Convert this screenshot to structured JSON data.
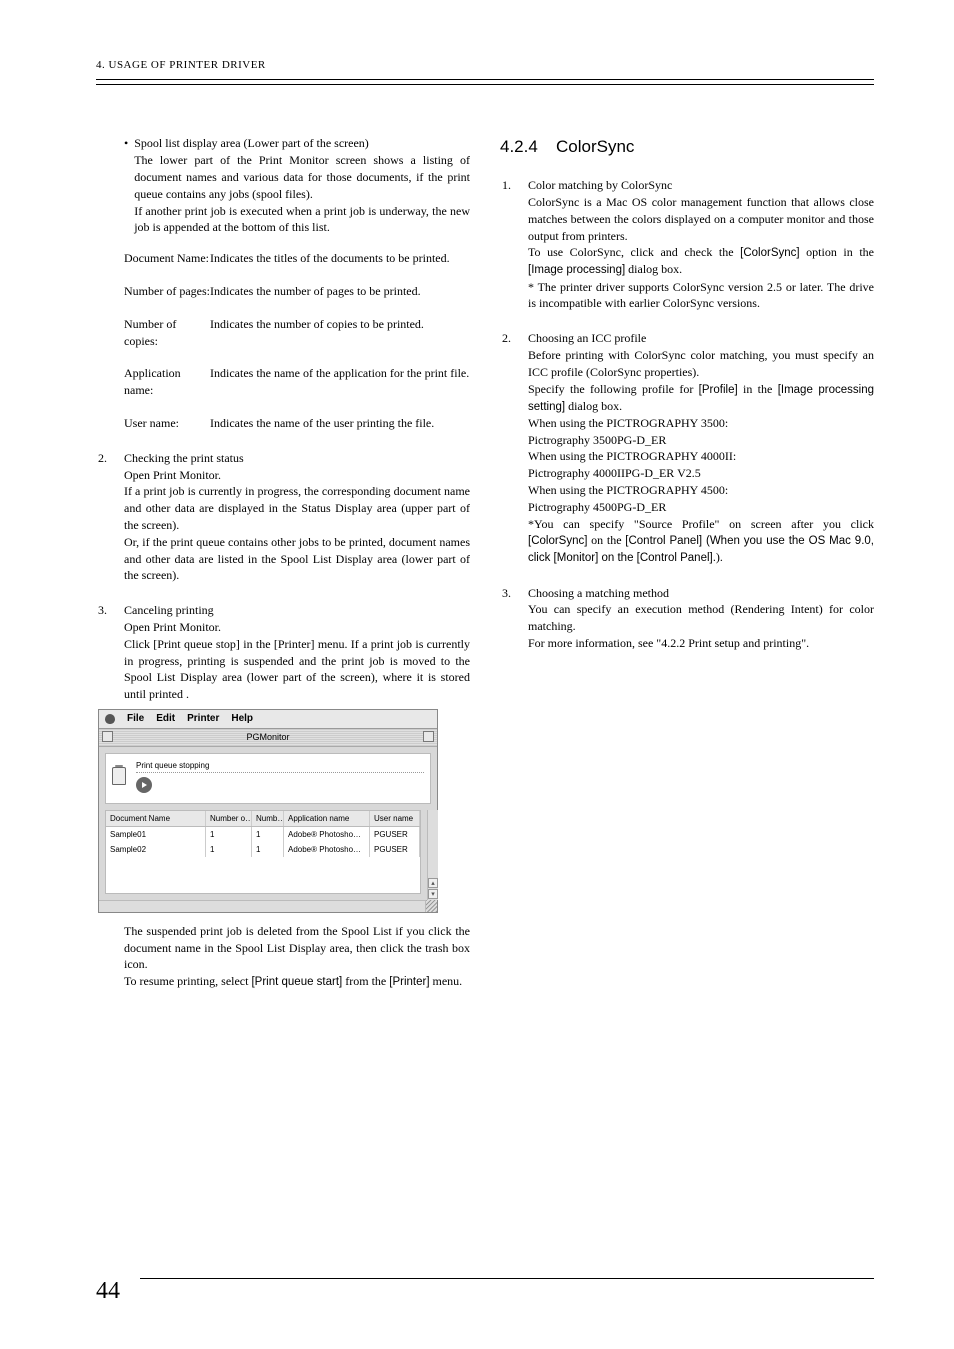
{
  "header": "4. USAGE OF PRINTER DRIVER",
  "page_number": "44",
  "left": {
    "bullet": {
      "title": "Spool list display area (Lower part of the screen)",
      "p1": "The lower part of the Print Monitor screen shows a listing of document names and various data for those documents, if the print queue contains any jobs (spool files).",
      "p2": "If another print job is executed when a print job is underway, the new job is appended at the bottom of this list."
    },
    "defs": [
      {
        "term": "Document Name:",
        "desc": "Indicates the titles of the documents to be printed."
      },
      {
        "term": "Number of pages:",
        "desc": "Indicates the number of pages to be printed."
      },
      {
        "term": "Number of copies:",
        "desc": "Indicates the number of copies to be printed."
      },
      {
        "term": "Application name:",
        "desc": "Indicates the name of the application for the print file."
      },
      {
        "term": "User name:",
        "desc": "Indicates the name of the user printing the file."
      }
    ],
    "sec2": {
      "num": "2.",
      "title": "Checking the print status",
      "l1": "Open Print Monitor.",
      "p1": "If a print job is currently in progress, the corresponding document name and other data are displayed in the Status Display area (upper part of the screen).",
      "p2": "Or, if the print queue contains other jobs to be printed, document names and other data are listed in the Spool List Display area (lower part of the screen)."
    },
    "sec3": {
      "num": "3.",
      "title": "Canceling printing",
      "l1": "Open Print Monitor.",
      "p1": "Click [Print queue stop] in the [Printer] menu. If a print job is currently in progress, printing is suspended and the print job is moved to the Spool List Display area (lower part of the screen), where it is stored until printed ."
    },
    "monitor": {
      "menu": [
        "File",
        "Edit",
        "Printer",
        "Help"
      ],
      "title": "PGMonitor",
      "status": "Print queue stopping",
      "headers": {
        "doc": "Document Name",
        "np": "Number o…",
        "nc": "Numb…",
        "app": "Application name",
        "usr": "User name"
      },
      "rows": [
        {
          "doc": "Sample01",
          "np": "1",
          "nc": "1",
          "app": "Adobe® Photosho…",
          "usr": "PGUSER"
        },
        {
          "doc": "Sample02",
          "np": "1",
          "nc": "1",
          "app": "Adobe® Photosho…",
          "usr": "PGUSER"
        }
      ]
    },
    "after": {
      "p1": "The suspended print job is deleted from the Spool List if you click the document name in the Spool List Display area, then click the trash box icon.",
      "p2a": "To resume printing, select ",
      "p2b": "[Print queue start]",
      "p2c": " from the ",
      "p2d": "[Printer]",
      "p2e": " menu."
    }
  },
  "right": {
    "heading_num": "4.2.4",
    "heading": "ColorSync",
    "sec1": {
      "num": "1.",
      "title": "Color matching by ColorSync",
      "p1": "ColorSync is a Mac OS color management function that allows close matches between the colors displayed on a computer monitor and those output from printers.",
      "p2a": "To use ColorSync, click and check the ",
      "p2b": "[ColorSync]",
      "p2c": " option in the ",
      "p2d": "[Image processing]",
      "p2e": " dialog box.",
      "p3": "* The printer driver supports ColorSync version 2.5 or later. The drive is incompatible with earlier ColorSync versions."
    },
    "sec2": {
      "num": "2.",
      "title": "Choosing an ICC profile",
      "p1": "Before printing with ColorSync color matching, you must specify an ICC profile (ColorSync properties).",
      "p2a": "Specify the following profile for ",
      "p2b": "[Profile]",
      "p2c": " in the ",
      "p2d": "[Image processing setting]",
      "p2e": " dialog box.",
      "l1": "When using the PICTROGRAPHY 3500:",
      "l2": "Pictrography 3500PG-D_ER",
      "l3": "When using the PICTROGRAPHY 4000II:",
      "l4": "Pictrography 4000IIPG-D_ER V2.5",
      "l5": "When using the PICTROGRAPHY 4500:",
      "l6": "Pictrography 4500PG-D_ER",
      "p3a": "*You can specify \"Source Profile\" on screen after you click ",
      "p3b": "[ColorSync]",
      "p3c": " on the ",
      "p3d": "[Control Panel] (When you use the OS Mac 9.0, click [Monitor] on the [Control Panel].",
      "p3e": ")."
    },
    "sec3": {
      "num": "3.",
      "title": "Choosing a matching method",
      "p1": "You can specify an execution method (Rendering Intent) for color matching.",
      "p2": "For more information, see \"4.2.2 Print setup and printing\"."
    }
  }
}
